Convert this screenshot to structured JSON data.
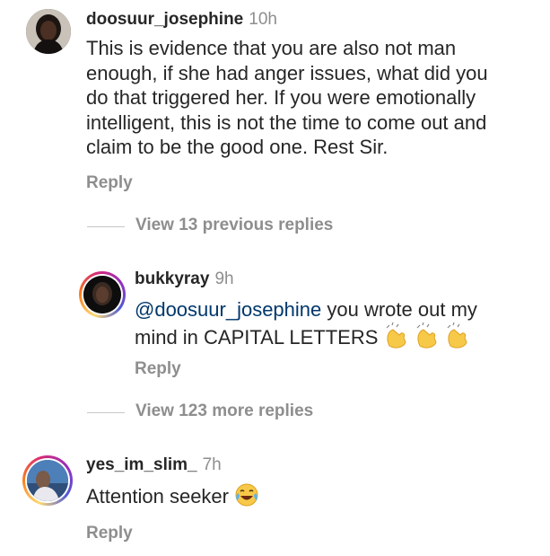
{
  "comment1": {
    "username": "doosuur_josephine",
    "time": "10h",
    "lines": [
      "This is evidence that you are also not man",
      "enough, if she had anger issues, what did you",
      "do that triggered her. If you were emotionally",
      "intelligent, this is not the time to come out and",
      "claim to be the good one. Rest Sir."
    ],
    "reply_label": "Reply"
  },
  "view_previous": "View 13 previous replies",
  "reply1": {
    "username": "bukkyray",
    "time": "9h",
    "mention": "@doosuur_josephine",
    "line1_rest": " you wrote out my",
    "line2": "mind in CAPITAL LETTERS",
    "emoji": "clapping-hands",
    "reply_label": "Reply"
  },
  "view_more": "View 123 more replies",
  "comment2": {
    "username": "yes_im_slim_",
    "time": "7h",
    "text": "Attention seeker",
    "emoji": "tears-of-joy",
    "reply_label": "Reply"
  }
}
